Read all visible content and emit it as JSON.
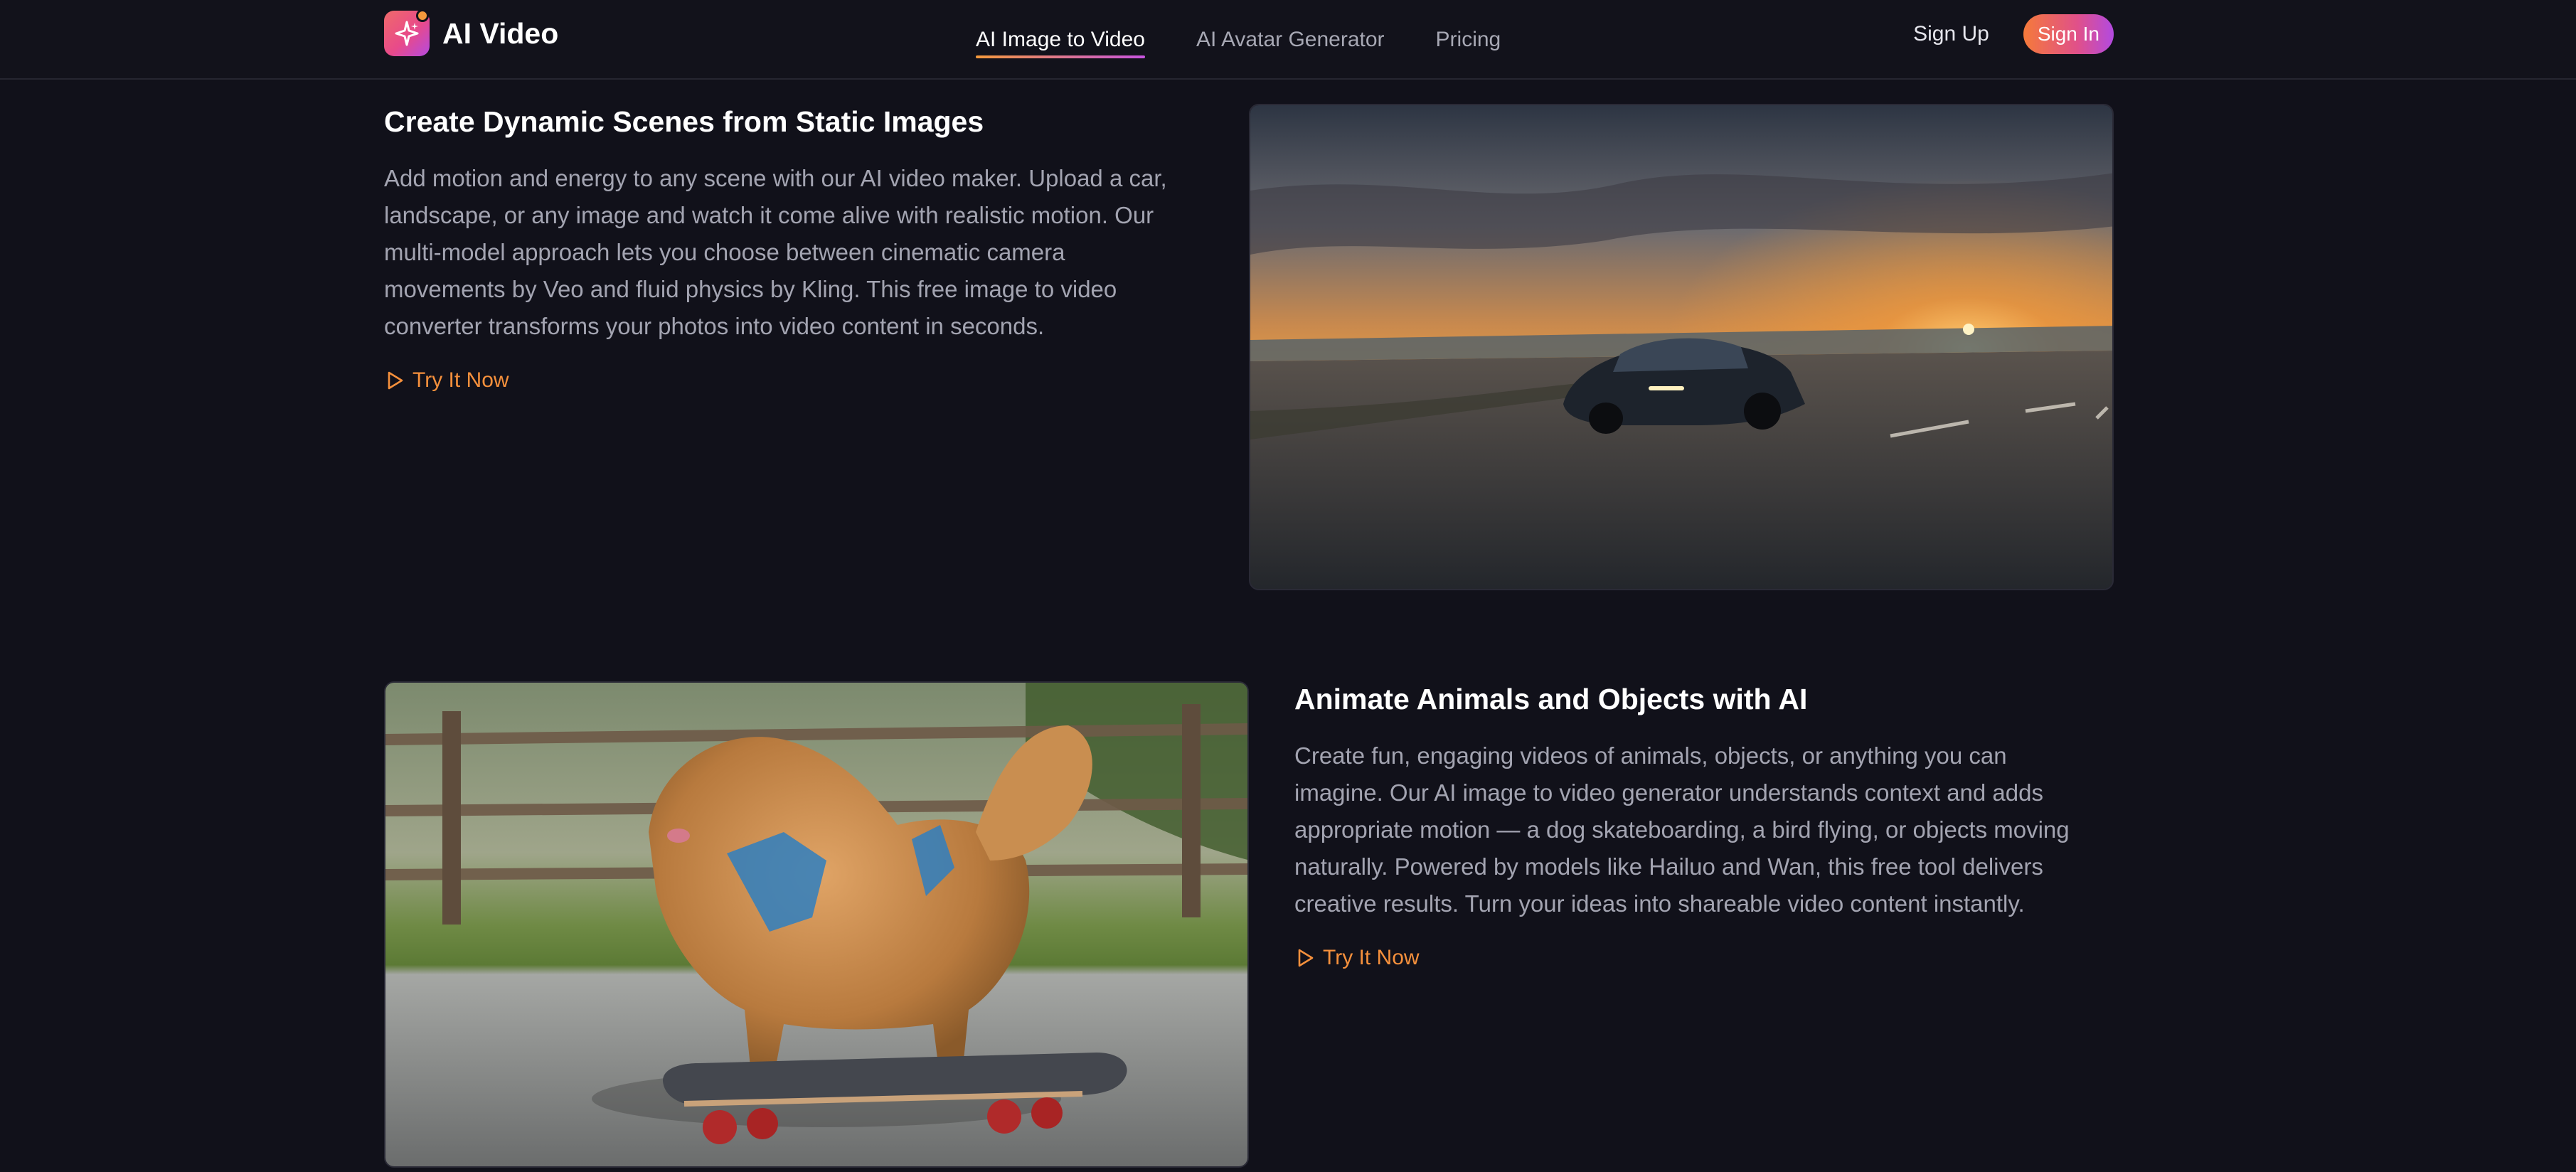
{
  "brand": {
    "name": "AI Video",
    "accent": "#f5903c",
    "gradient": [
      "#f57a3a",
      "#e0508a",
      "#b24ae0"
    ]
  },
  "nav": {
    "items": [
      {
        "label": "AI Image to Video",
        "active": true
      },
      {
        "label": "AI Avatar Generator",
        "active": false
      },
      {
        "label": "Pricing",
        "active": false
      }
    ]
  },
  "auth": {
    "signup": "Sign Up",
    "signin": "Sign In"
  },
  "sections": [
    {
      "title": "Create Dynamic Scenes from Static Images",
      "lines": [
        "Add motion and energy to any scene with our AI video maker. Upload a car,",
        "landscape, or any image and watch it come alive with realistic motion. Our",
        "multi-model approach lets you choose between cinematic camera",
        "movements by Veo and fluid physics by Kling. This free image to video",
        "converter transforms your photos into video content in seconds."
      ],
      "cta": "Try It Now",
      "image": "sports-car-sunset-road"
    },
    {
      "title": "Animate Animals and Objects with AI",
      "lines": [
        "Create fun, engaging videos of animals, objects, or anything you can",
        "imagine. Our AI image to video generator understands context and adds",
        "appropriate motion — a dog skateboarding, a bird flying, or objects moving",
        "naturally. Powered by models like Hailuo and Wan, this free tool delivers",
        "creative results. Turn your ideas into shareable video content instantly."
      ],
      "cta": "Try It Now",
      "image": "dog-on-skateboard"
    }
  ]
}
